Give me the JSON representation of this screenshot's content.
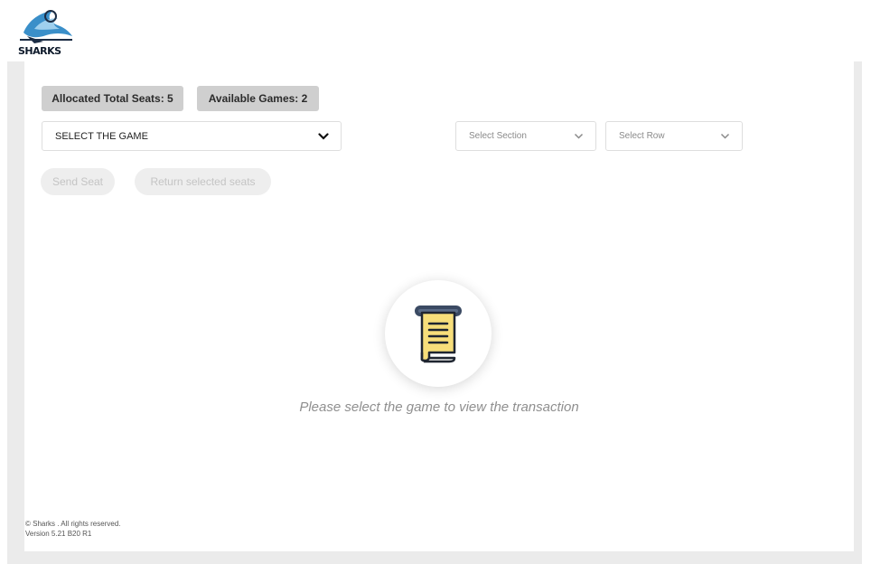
{
  "brand": {
    "logo_text": "SHARKS"
  },
  "badges": {
    "allocated": "Allocated Total Seats: 5",
    "games": "Available Games: 2"
  },
  "selects": {
    "game": "SELECT THE GAME",
    "section": "Select Section",
    "row": "Select Row"
  },
  "buttons": {
    "send": "Send Seat",
    "return": "Return selected seats"
  },
  "empty_state": {
    "message": "Please select the game to view the transaction",
    "icon": "receipt-icon"
  },
  "footer": {
    "copyright": "© Sharks . All rights reserved.",
    "version": "Version 5.21 B20 R1"
  },
  "colors": {
    "badge_bg": "#cfcfcf",
    "panel_bg": "#ebebeb",
    "receipt_yellow": "#f7de7a",
    "receipt_roller": "#3b4a63"
  }
}
